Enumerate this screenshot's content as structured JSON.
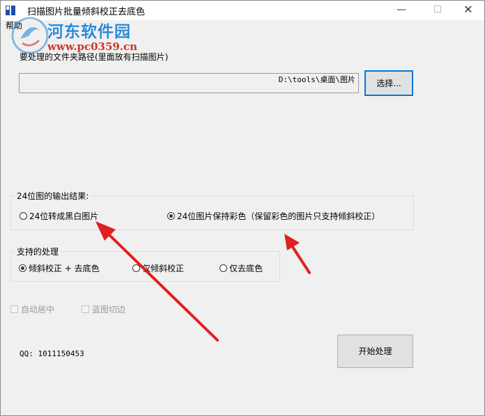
{
  "window": {
    "title": "扫描图片批量倾斜校正去底色",
    "minimize_glyph": "—",
    "maximize_glyph": "☐",
    "close_glyph": "✕"
  },
  "menu": {
    "help": "帮助"
  },
  "watermark": {
    "name": "河东软件园",
    "url": "www.pc0359.cn"
  },
  "folder": {
    "label": "要处理的文件夹路径(里面放有扫描图片)",
    "path_value": "D:\\tools\\桌面\\图片",
    "choose_button": "选择..."
  },
  "output_group": {
    "legend": "24位图的输出结果:",
    "options": [
      {
        "label": "24位转成黑白图片",
        "selected": false
      },
      {
        "label": "24位图片保持彩色（保留彩色的图片只支持倾斜校正）",
        "selected": true
      }
    ]
  },
  "process_group": {
    "legend": "支持的处理",
    "options": [
      {
        "label": "倾斜校正 + 去底色",
        "selected": true
      },
      {
        "label": "仅倾斜校正",
        "selected": false
      },
      {
        "label": "仅去底色",
        "selected": false
      }
    ]
  },
  "checkboxes": [
    {
      "label": "自动居中",
      "checked": false,
      "enabled": false
    },
    {
      "label": "蓝图切边",
      "checked": false,
      "enabled": false
    }
  ],
  "qq_text": "QQ: 1011150453",
  "start_button": "开始处理",
  "colors": {
    "accent_border": "#0078d7",
    "arrow": "#e02020",
    "watermark_blue": "#2b8ad6",
    "watermark_red": "#d0342c"
  }
}
